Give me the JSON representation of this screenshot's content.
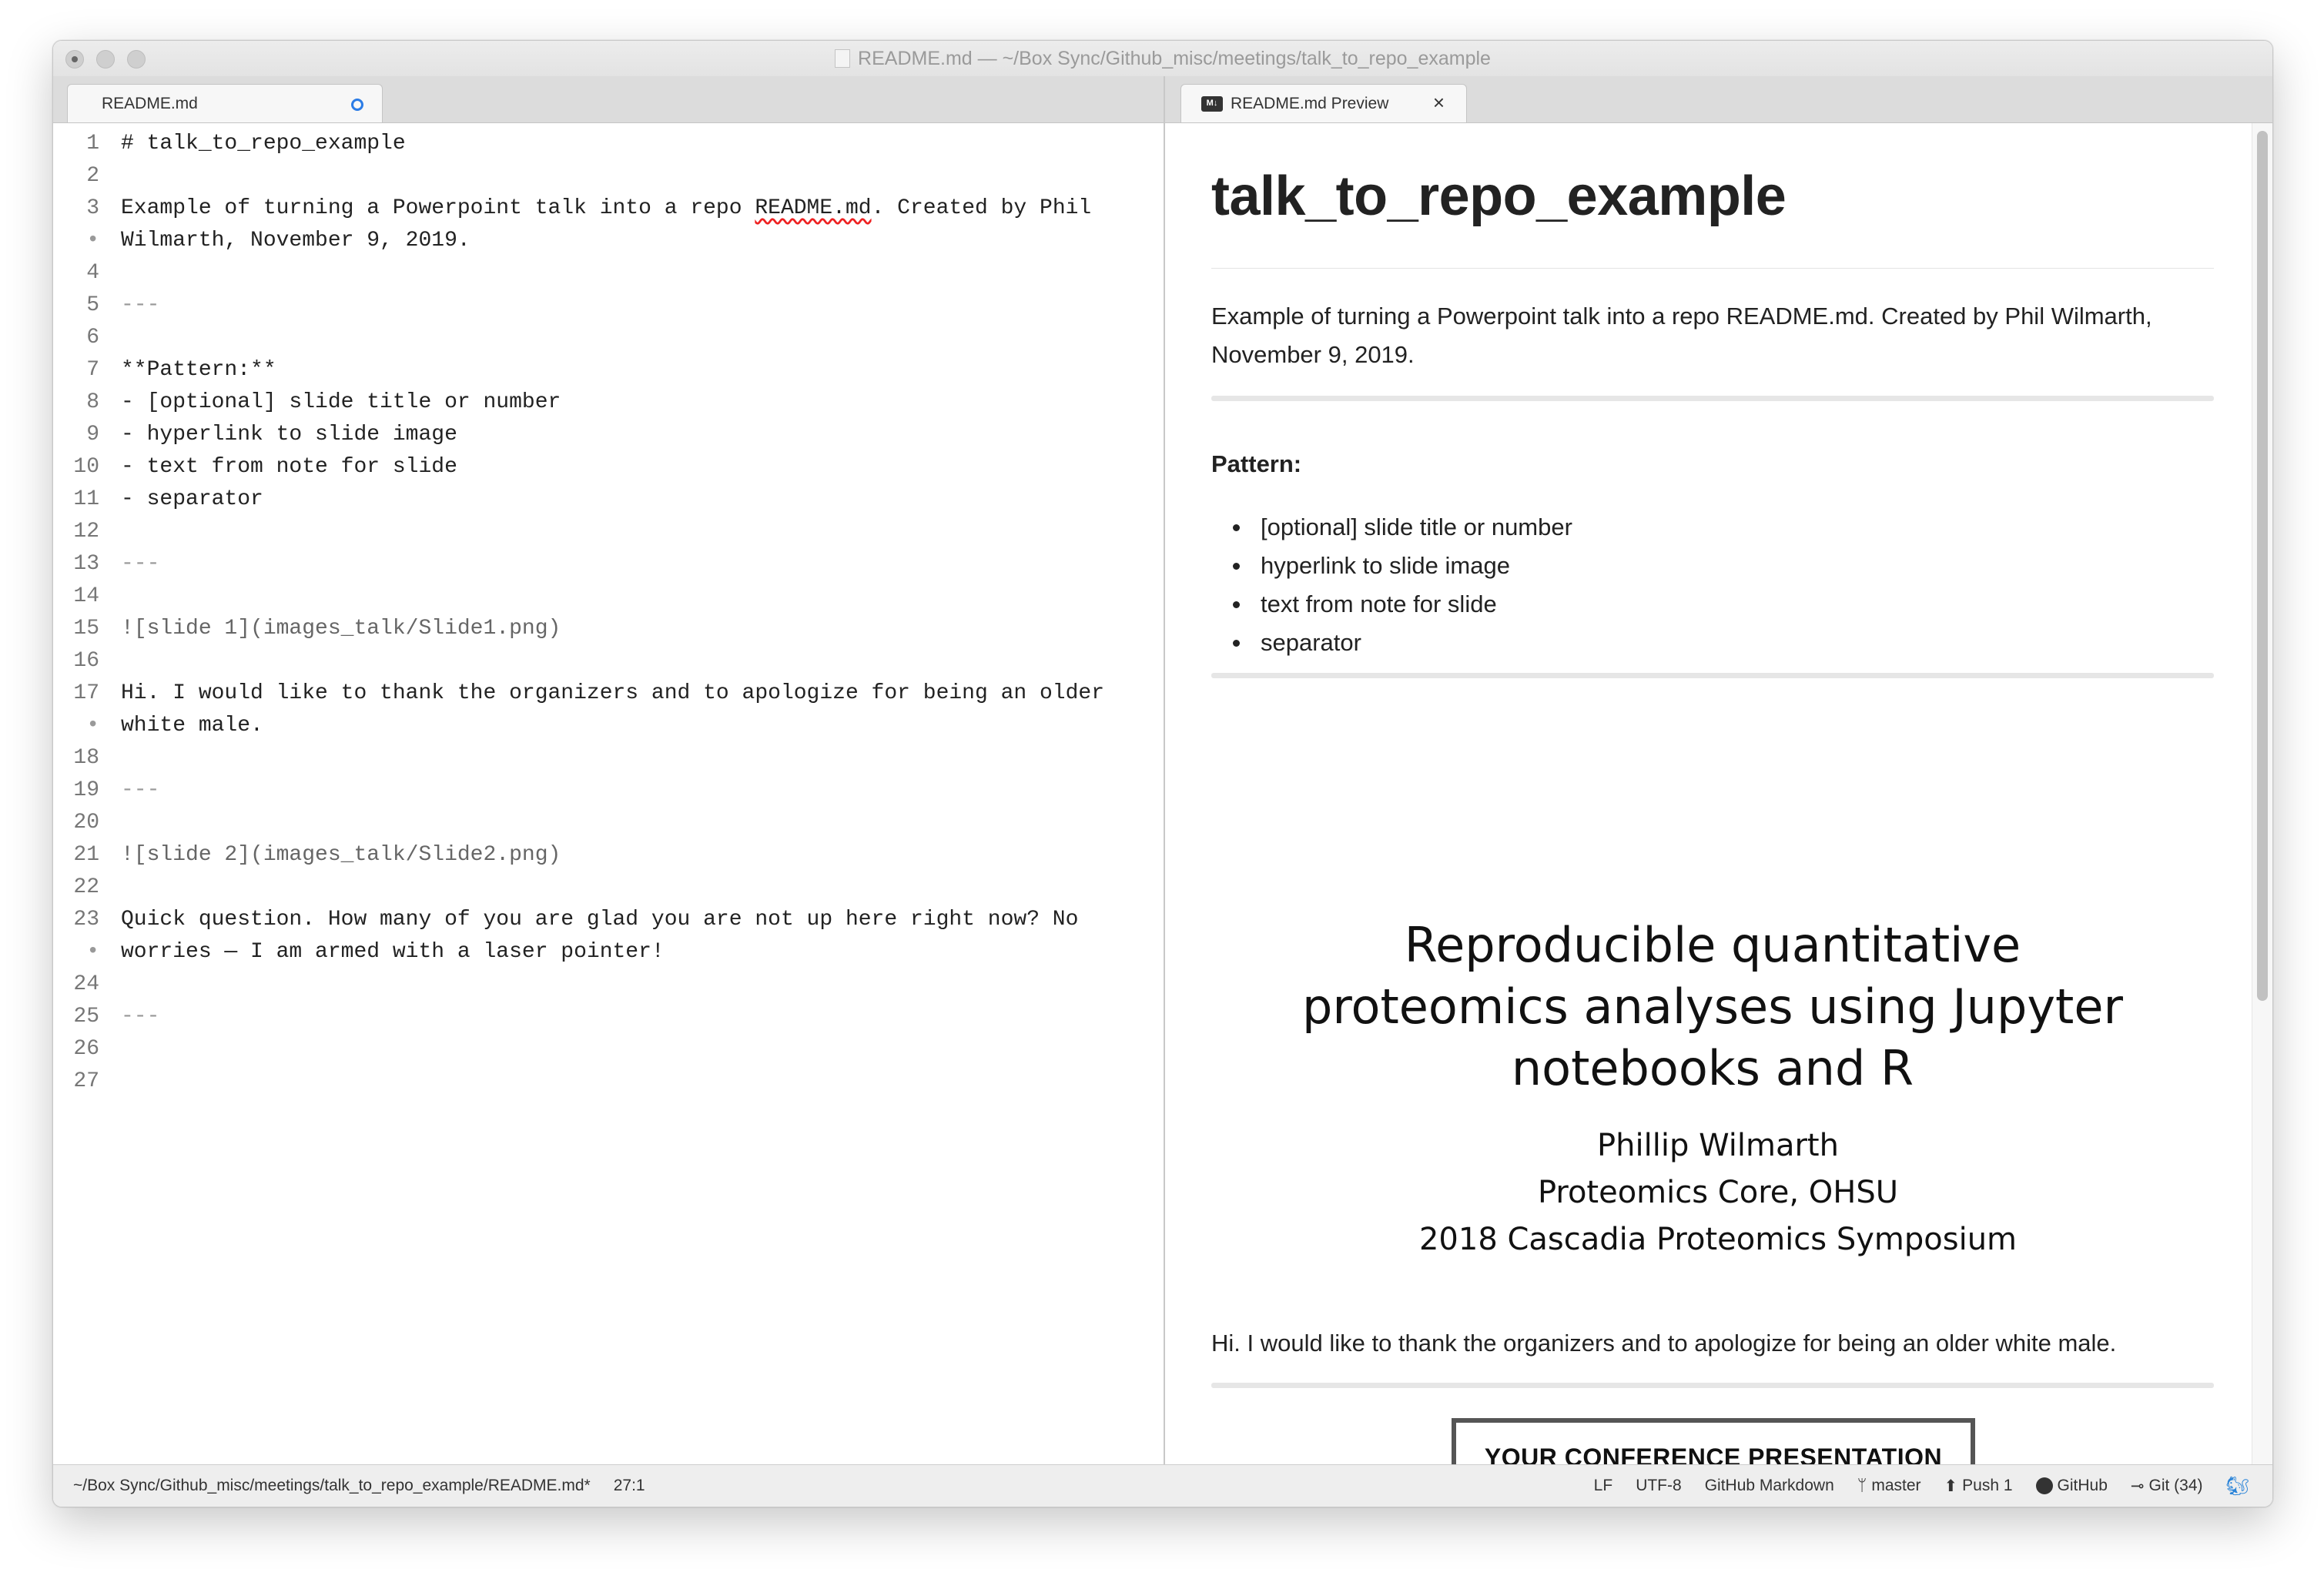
{
  "window": {
    "title": "README.md — ~/Box Sync/Github_misc/meetings/talk_to_repo_example"
  },
  "left_tab": {
    "label": "README.md"
  },
  "right_tab": {
    "label": "README.md Preview",
    "icon_text": "M↓",
    "close": "×"
  },
  "editor": {
    "lines": [
      {
        "num": "1",
        "text": "# talk_to_repo_example"
      },
      {
        "num": "2",
        "text": ""
      },
      {
        "num": "3",
        "text_a": "Example of turning a Powerpoint talk into a repo ",
        "text_b": "README.md",
        "text_c": ". Created by Phil"
      },
      {
        "num": "•",
        "text": "Wilmarth, November 9, 2019."
      },
      {
        "num": "4",
        "text": ""
      },
      {
        "num": "5",
        "text": "---"
      },
      {
        "num": "6",
        "text": ""
      },
      {
        "num": "7",
        "text": "**Pattern:**"
      },
      {
        "num": "8",
        "text": "- [optional] slide title or number"
      },
      {
        "num": "9",
        "text": "- hyperlink to slide image"
      },
      {
        "num": "10",
        "text": "- text from note for slide"
      },
      {
        "num": "11",
        "text": "- separator"
      },
      {
        "num": "12",
        "text": ""
      },
      {
        "num": "13",
        "text": "---"
      },
      {
        "num": "14",
        "text": ""
      },
      {
        "num": "15",
        "text": "![slide 1](images_talk/Slide1.png)"
      },
      {
        "num": "16",
        "text": ""
      },
      {
        "num": "17",
        "text": "Hi. I would like to thank the organizers and to apologize for being an older"
      },
      {
        "num": "•",
        "text": "white male."
      },
      {
        "num": "18",
        "text": ""
      },
      {
        "num": "19",
        "text": "---"
      },
      {
        "num": "20",
        "text": ""
      },
      {
        "num": "21",
        "text": "![slide 2](images_talk/Slide2.png)"
      },
      {
        "num": "22",
        "text": ""
      },
      {
        "num": "23",
        "text": "Quick question. How many of you are glad you are not up here right now? No"
      },
      {
        "num": "•",
        "text": "worries — I am armed with a laser pointer!"
      },
      {
        "num": "24",
        "text": ""
      },
      {
        "num": "25",
        "text": "---"
      },
      {
        "num": "26",
        "text": ""
      },
      {
        "num": "27",
        "text": ""
      }
    ]
  },
  "preview": {
    "heading": "talk_to_repo_example",
    "intro_line1": "Example of turning a Powerpoint talk into a repo README.md. Created by Phil Wilmarth,",
    "intro_line2": "November 9, 2019.",
    "pattern_label": "Pattern:",
    "pattern_items": [
      "[optional] slide title or number",
      "hyperlink to slide image",
      "text from note for slide",
      "separator"
    ],
    "slide1": {
      "title_line1": "Reproducible quantitative",
      "title_line2": "proteomics analyses using Jupyter",
      "title_line3": "notebooks and R",
      "author": "Phillip Wilmarth",
      "affiliation": "Proteomics Core, OHSU",
      "event": "2018 Cascadia Proteomics Symposium"
    },
    "note1": "Hi. I would like to thank the organizers and to apologize for being an older white male.",
    "slide2_caption": "YOUR CONFERENCE PRESENTATION"
  },
  "status": {
    "path": "~/Box Sync/Github_misc/meetings/talk_to_repo_example/README.md*",
    "cursor": "27:1",
    "line_ending": "LF",
    "encoding": "UTF-8",
    "grammar": "GitHub Markdown",
    "branch": "master",
    "push": "Push 1",
    "github": "GitHub",
    "git": "Git (34)"
  }
}
